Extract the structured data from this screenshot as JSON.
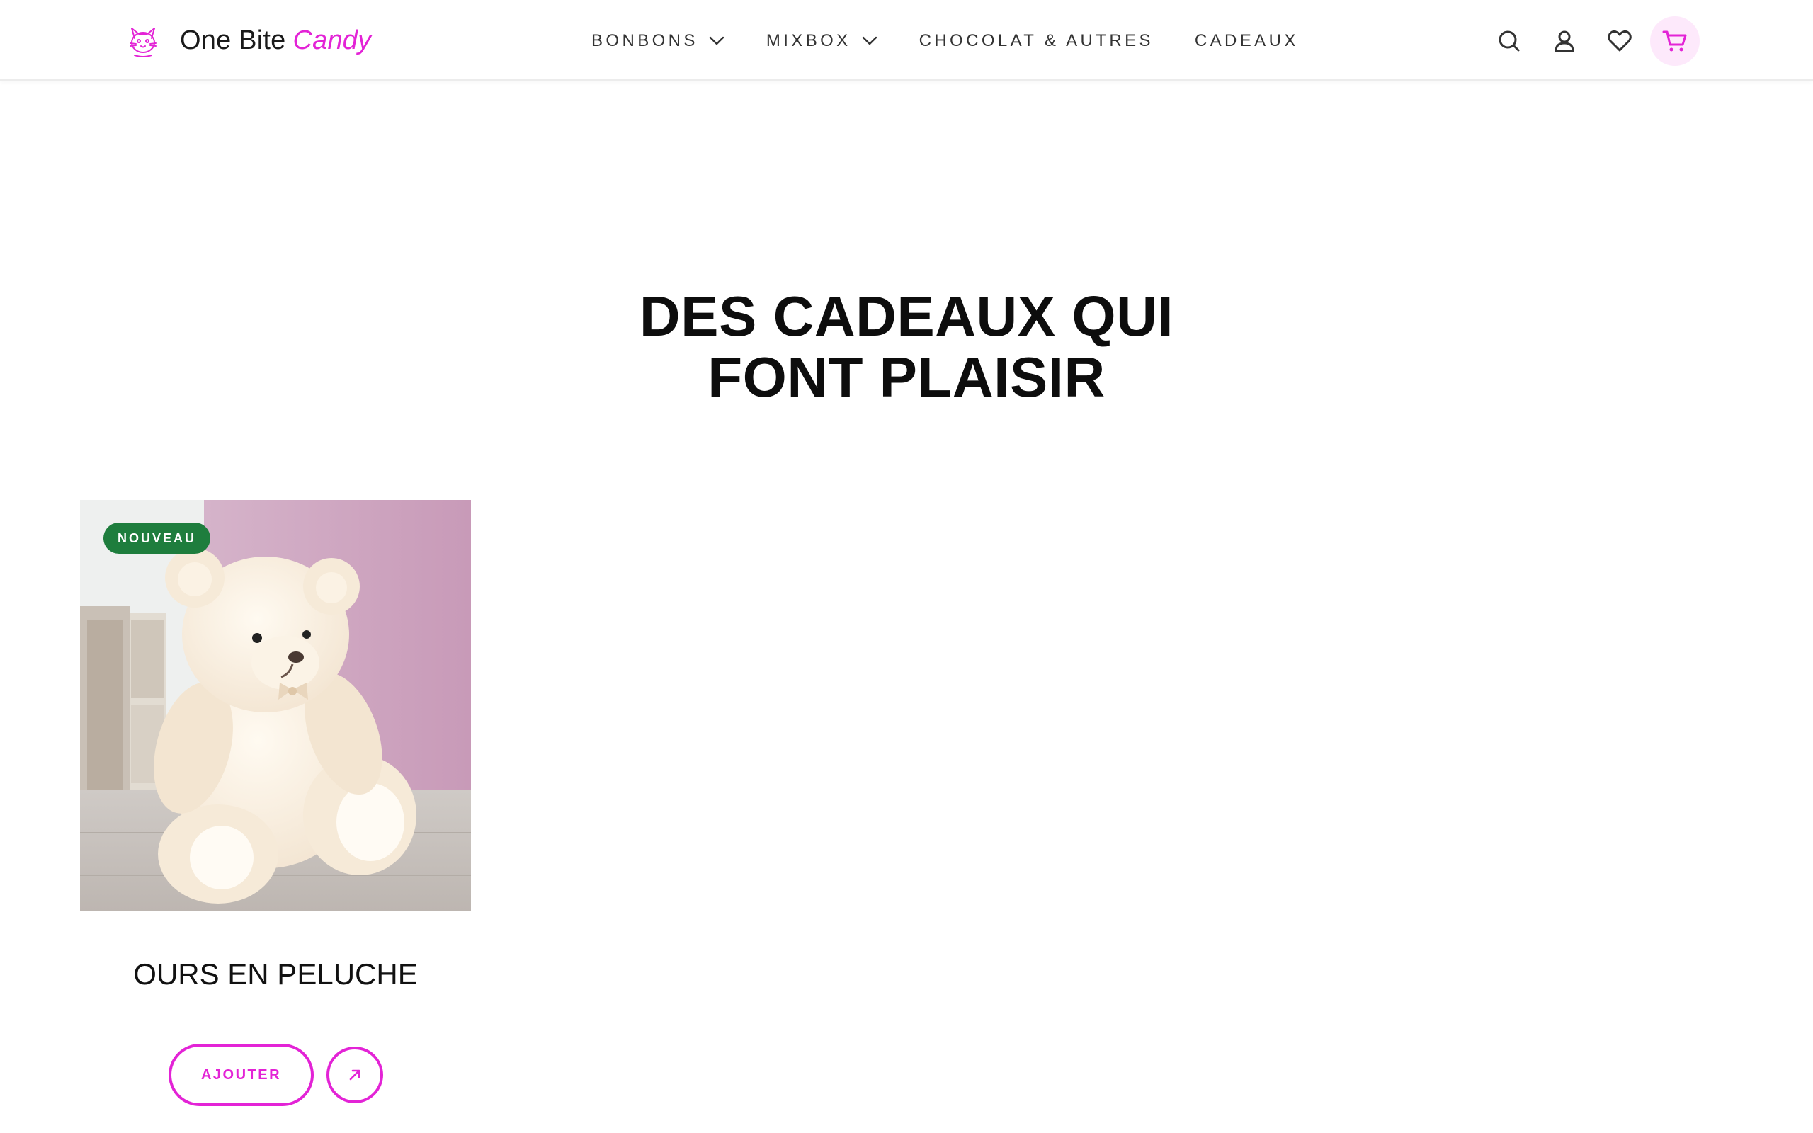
{
  "brand": {
    "name_main": "One Bite",
    "name_accent": "Candy",
    "accent_color": "#e323d6"
  },
  "nav": {
    "items": [
      {
        "label": "BONBONS",
        "has_dropdown": true
      },
      {
        "label": "MIXBOX",
        "has_dropdown": true
      },
      {
        "label": "CHOCOLAT & AUTRES",
        "has_dropdown": false
      },
      {
        "label": "CADEAUX",
        "has_dropdown": false
      }
    ]
  },
  "header_icons": [
    "search-icon",
    "account-icon",
    "heart-icon",
    "cart-icon"
  ],
  "hero": {
    "title": "DES CADEAUX QUI\nFONT PLAISIR"
  },
  "products": [
    {
      "name": "OURS EN PELUCHE",
      "badge": "NOUVEAU",
      "badge_color": "#1e7d3d",
      "image": "teddy-bear-photo",
      "add_label": "AJOUTER",
      "view_icon": "arrow-up-right-icon"
    }
  ]
}
